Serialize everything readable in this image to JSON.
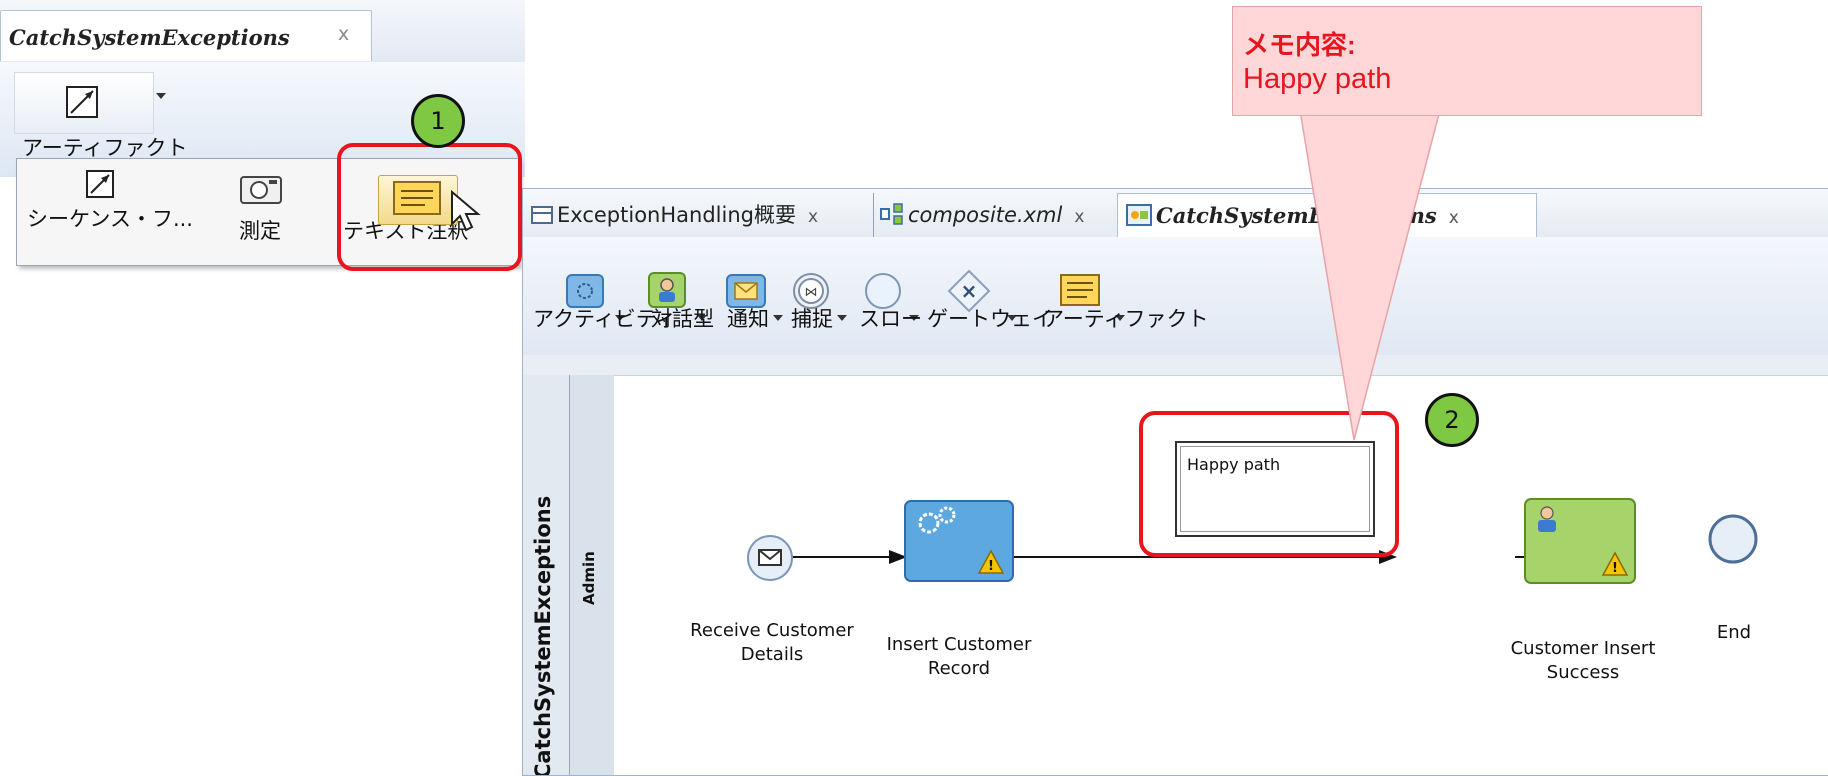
{
  "left_panel": {
    "tab_title": "CatchSystemExceptions",
    "tab_close": "x",
    "artifact_label": "アーティファクト",
    "popup_items": [
      {
        "label": "シーケンス・フ...",
        "icon": "sequence-flow-icon"
      },
      {
        "label": "測定",
        "icon": "camera-icon"
      },
      {
        "label": "テキスト注釈",
        "icon": "text-annotation-icon"
      }
    ],
    "callout_1": "1"
  },
  "editor": {
    "tabs": [
      {
        "label": "ExceptionHandling概要",
        "close": "x",
        "icon": "overview-icon"
      },
      {
        "label": "composite.xml",
        "close": "x",
        "icon": "composite-icon"
      },
      {
        "label": "CatchSystemExceptions",
        "close": "x",
        "icon": "process-icon"
      }
    ],
    "palette": [
      {
        "label": "アクティビティ",
        "icon": "activity-icon"
      },
      {
        "label": "対話型",
        "icon": "interactive-icon"
      },
      {
        "label": "通知",
        "icon": "notification-icon"
      },
      {
        "label": "捕捉",
        "icon": "catch-icon"
      },
      {
        "label": "スロー",
        "icon": "throw-icon"
      },
      {
        "label": "ゲートウェイ",
        "icon": "gateway-icon"
      },
      {
        "label": "アーティファクト",
        "icon": "artifact-icon"
      }
    ],
    "pool_label": "CatchSystemExceptions",
    "lane_label": "Admin",
    "annotation_text": "Happy path",
    "callout_2": "2",
    "nodes": {
      "receive_line1": "Receive Customer",
      "receive_line2": "Details",
      "insert_line1": "Insert Customer",
      "insert_line2": "Record",
      "success_line1": "Customer Insert",
      "success_line2": "Success",
      "end": "End"
    }
  },
  "memo": {
    "title": "メモ内容:",
    "text": "Happy path"
  },
  "colors": {
    "highlight": "#e8141e",
    "callout": "#7ec843",
    "memo_bg": "#ffd7d9"
  }
}
